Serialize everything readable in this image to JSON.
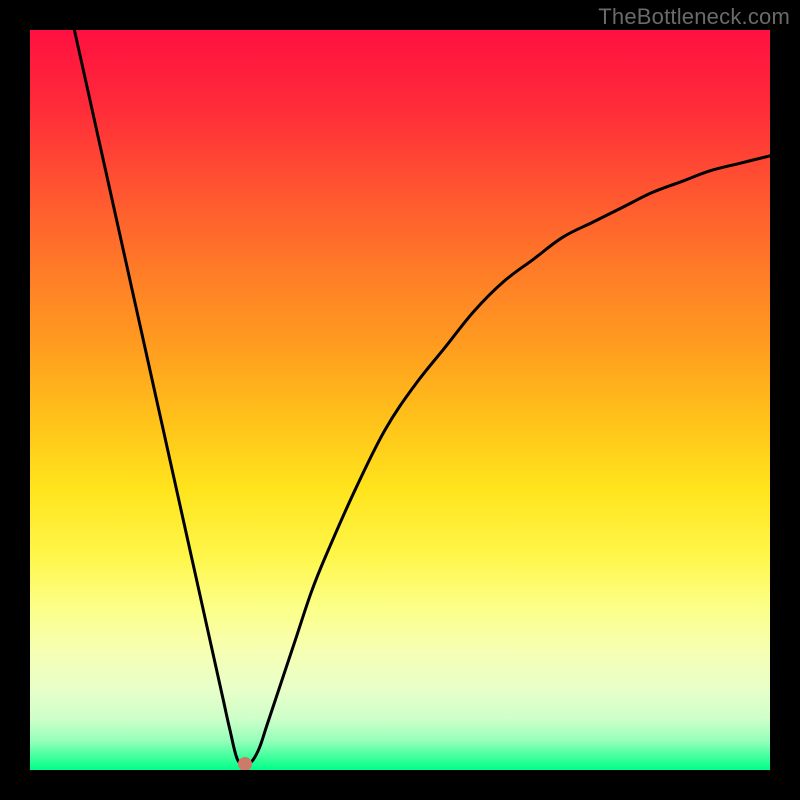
{
  "watermark": "TheBottleneck.com",
  "chart_data": {
    "type": "line",
    "title": "",
    "xlabel": "",
    "ylabel": "",
    "xlim": [
      0,
      100
    ],
    "ylim": [
      0,
      100
    ],
    "grid": false,
    "series": [
      {
        "name": "curve",
        "x": [
          6,
          8,
          10,
          12,
          14,
          16,
          18,
          20,
          22,
          24,
          26,
          27,
          28,
          29,
          30,
          31,
          32,
          34,
          36,
          38,
          40,
          44,
          48,
          52,
          56,
          60,
          64,
          68,
          72,
          76,
          80,
          84,
          88,
          92,
          96,
          100
        ],
        "y": [
          100,
          91,
          82,
          73,
          64,
          55,
          46,
          37,
          28,
          19,
          10,
          5.5,
          1.5,
          0.8,
          1.2,
          3,
          6,
          12,
          18,
          24,
          29,
          38,
          46,
          52,
          57,
          62,
          66,
          69,
          72,
          74,
          76,
          78,
          79.5,
          81,
          82,
          83
        ]
      }
    ],
    "marker_point": {
      "x": 29,
      "y": 0.8
    },
    "background_gradient": {
      "top_color": "#ff1040",
      "mid_color": "#ffe41c",
      "bottom_color": "#00ff88"
    }
  }
}
